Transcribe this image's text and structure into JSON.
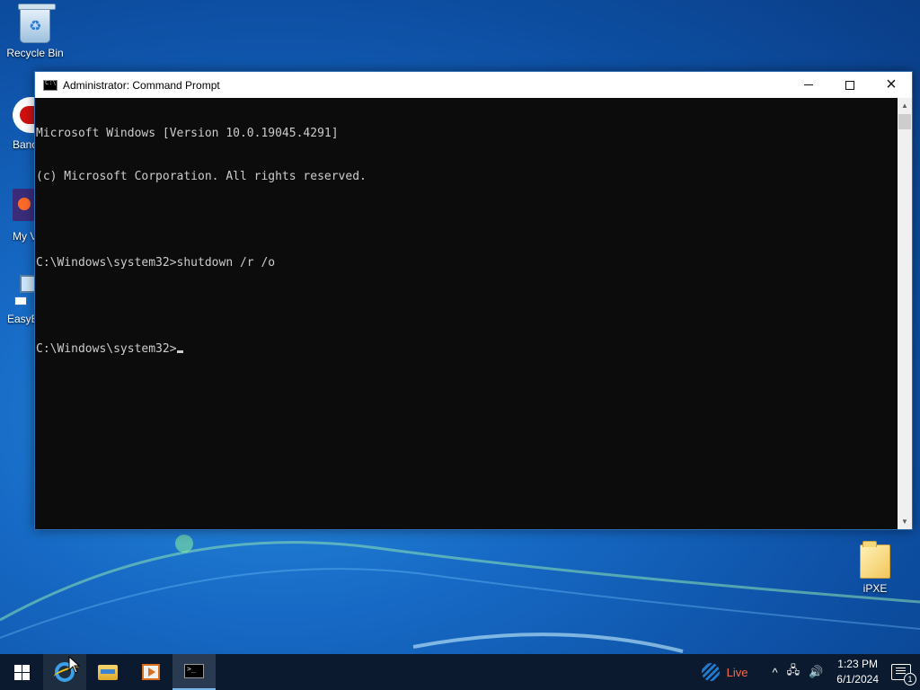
{
  "desktop": {
    "icons": [
      {
        "label": "Recycle Bin"
      },
      {
        "label": "Band"
      },
      {
        "label": "My V"
      },
      {
        "label": "EasyB"
      },
      {
        "label": "iPXE"
      }
    ]
  },
  "window": {
    "title": "Administrator: Command Prompt",
    "buttons": {
      "minimize": "minimize",
      "maximize": "maximize",
      "close": "×"
    },
    "console_lines": [
      "Microsoft Windows [Version 10.0.19045.4291]",
      "(c) Microsoft Corporation. All rights reserved.",
      "",
      "C:\\Windows\\system32>shutdown /r /o",
      "",
      "C:\\Windows\\system32>"
    ]
  },
  "taskbar": {
    "items": [
      "start-icon",
      "internet-explorer-icon",
      "file-explorer-icon",
      "media-player-icon",
      "command-prompt-icon"
    ],
    "tray": {
      "live_label": "Live",
      "chevron": "^",
      "time": "1:23 PM",
      "date": "6/1/2024",
      "notification_count": "1"
    }
  },
  "colors": {
    "console_bg": "#0c0c0c",
    "console_fg": "#cccccc",
    "taskbar": "#0b1a2e",
    "live_text": "#ff6a4a"
  }
}
